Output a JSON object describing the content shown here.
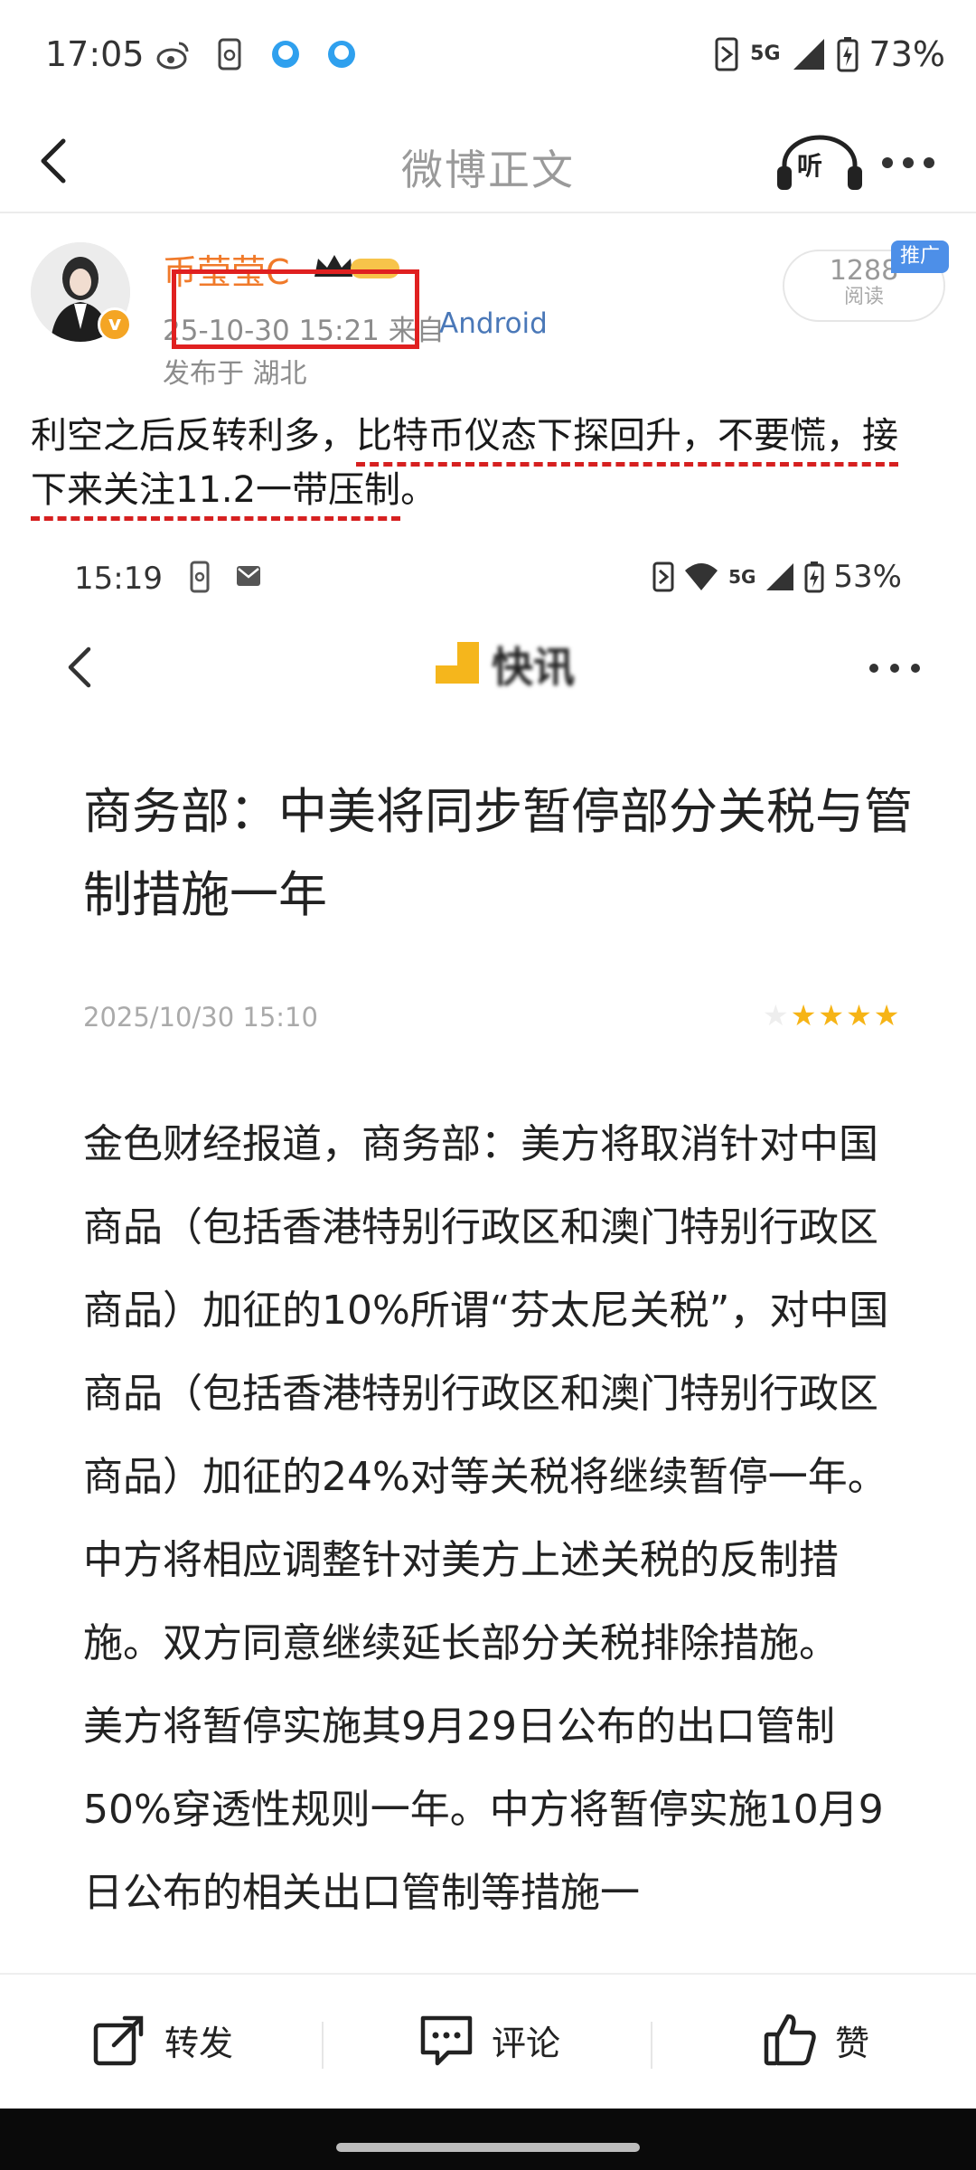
{
  "status_bar": {
    "time": "17:05",
    "network": "5G",
    "battery": "73%",
    "icons": [
      "weibo-icon",
      "phone-lock-icon",
      "qq-icon",
      "qq-icon",
      "nfc-icon",
      "signal-icon",
      "battery-icon"
    ]
  },
  "header": {
    "title": "微博正文",
    "listen_label": "听"
  },
  "author": {
    "name": "币莹莹C",
    "verified_badge": "v",
    "time": "25-10-30 15:21",
    "source_prefix": "来自",
    "source": "Android",
    "location": "发布于 湖北",
    "read_count": "1288",
    "read_label": "阅读",
    "promo_tag": "推广"
  },
  "post": {
    "text_plain": "利空之后反转利多，",
    "text_underlined_1": "比特币仪态下探回升，不要慌，接",
    "text_underlined_2": "下来关注11.2一带压制",
    "text_tail": "。"
  },
  "embedded": {
    "status_time": "15:19",
    "status_network": "5G",
    "status_battery": "53%",
    "brand": "快讯",
    "title": "商务部：中美将同步暂停部分关税与管制措施一年",
    "date": "2025/10/30 15:10",
    "rating": 4,
    "rating_max": 5,
    "body": "金色财经报道，商务部：美方将取消针对中国商品（包括香港特别行政区和澳门特别行政区商品）加征的10%所谓“芬太尼关税”，对中国商品（包括香港特别行政区和澳门特别行政区商品）加征的24%对等关税将继续暂停一年。中方将相应调整针对美方上述关税的反制措施。双方同意继续延长部分关税排除措施。\n美方将暂停实施其9月29日公布的出口管制50%穿透性规则一年。中方将暂停实施10月9日公布的相关出口管制等措施一"
  },
  "actions": {
    "forward": "转发",
    "comment": "评论",
    "like": "赞"
  },
  "colors": {
    "author_name": "#f07a2a",
    "source_link": "#4a78b8",
    "annotation_red": "#e02020",
    "star": "#f6b416",
    "promo": "#4d8fe8"
  }
}
